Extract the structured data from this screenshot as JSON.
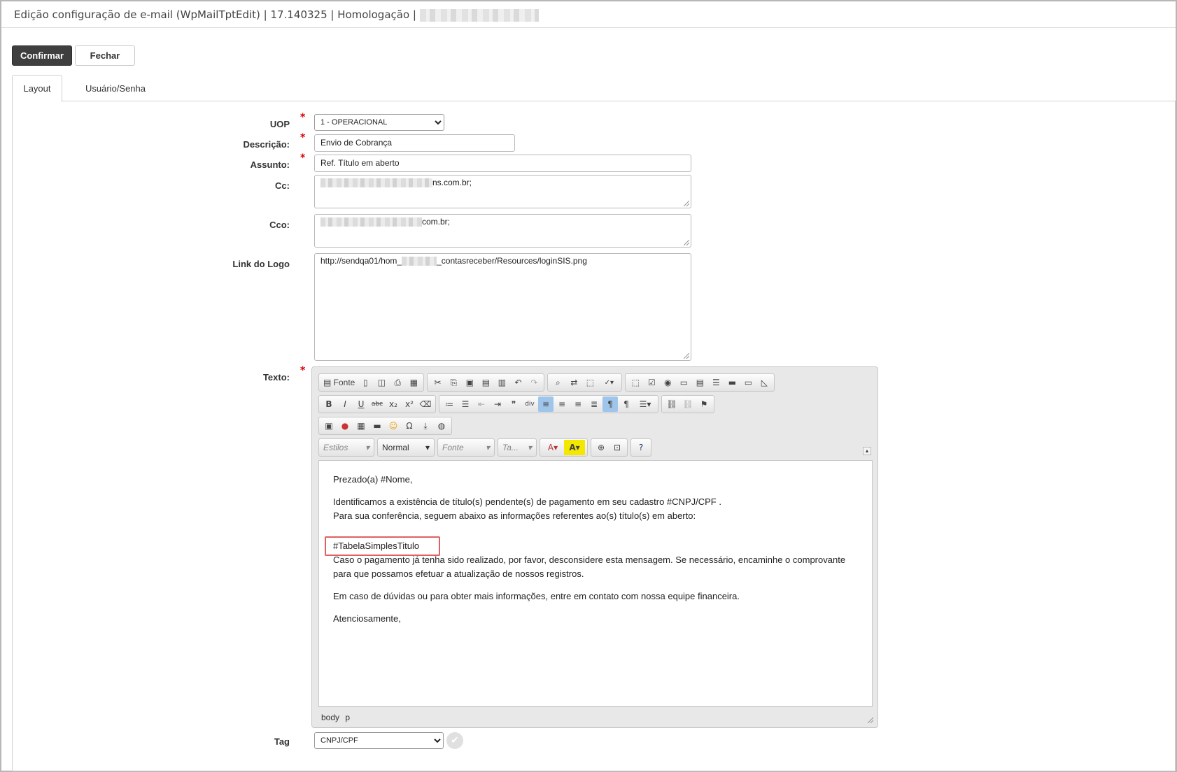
{
  "window": {
    "title": "Edição configuração de e-mail (WpMailTptEdit) | 17.140325 | Homologação |"
  },
  "actions": {
    "confirm_label": "Confirmar",
    "close_label": "Fechar"
  },
  "tabs": [
    {
      "label": "Layout",
      "active": true
    },
    {
      "label": "Usuário/Senha",
      "active": false
    }
  ],
  "form": {
    "required_mark": "*",
    "uop": {
      "label": "UOP",
      "value": "1 - OPERACIONAL"
    },
    "descricao": {
      "label": "Descrição:",
      "value": "Envio de Cobrança"
    },
    "assunto": {
      "label": "Assunto:",
      "value": "Ref. Título em aberto"
    },
    "cc": {
      "label": "Cc:",
      "value": "ns.com.br;"
    },
    "cco": {
      "label": "Cco:",
      "value": "com.br;"
    },
    "link_logo": {
      "label": "Link do Logo",
      "value_start": "http://sendqa01/hom_",
      "value_end": "_contasreceber/Resources/loginSIS.png"
    },
    "texto": {
      "label": "Texto:"
    },
    "tag": {
      "label": "Tag",
      "value": "CNPJ/CPF"
    }
  },
  "editor": {
    "toolbar": {
      "source_label": "Fonte",
      "styles_placeholder": "Estilos",
      "format_value": "Normal",
      "font_placeholder": "Fonte",
      "size_placeholder": "Ta..."
    },
    "content": {
      "greeting": "Prezado(a) #Nome,",
      "line1": "Identificamos a existência de título(s) pendente(s) de pagamento em seu cadastro #CNPJ/CPF .",
      "line2": "Para sua conferência, seguem abaixo as informações referentes ao(s) título(s) em aberto:",
      "table_tag": "#TabelaSimplesTitulo",
      "para2_line1": "Caso o pagamento já tenha sido realizado, por favor, desconsidere esta mensagem. Se necessário, encaminhe o comprovante",
      "para2_line2": "para que possamos efetuar a atualização de nossos registros.",
      "para3": "Em caso de dúvidas ou para obter mais informações, entre em contato com nossa equipe financeira.",
      "closing": "Atenciosamente,"
    },
    "path": "body  p"
  },
  "colors": {
    "primary_button": "#3f3f3f",
    "required": "#dd0000",
    "highlight_border": "#e06060",
    "active_tool": "#9fc6ea"
  }
}
